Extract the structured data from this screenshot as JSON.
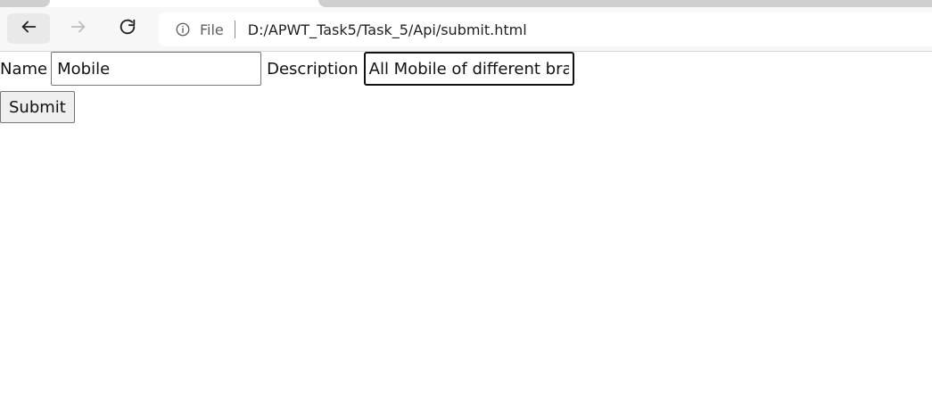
{
  "browser": {
    "address_bar": {
      "scheme_label": "File",
      "url": "D:/APWT_Task5/Task_5/Api/submit.html",
      "info_icon": "info-icon"
    },
    "nav": {
      "back_icon": "back-arrow-icon",
      "forward_icon": "forward-arrow-icon",
      "refresh_icon": "refresh-icon"
    }
  },
  "form": {
    "name_label": "Name",
    "name_value": "Mobile",
    "description_label": "Description",
    "description_value": "All Mobile of different bra",
    "submit_label": "Submit"
  },
  "colors": {
    "toolbar_bg": "#f7f7f7",
    "tab_inactive": "#cfcfcf",
    "page_bg": "#ffffff"
  }
}
